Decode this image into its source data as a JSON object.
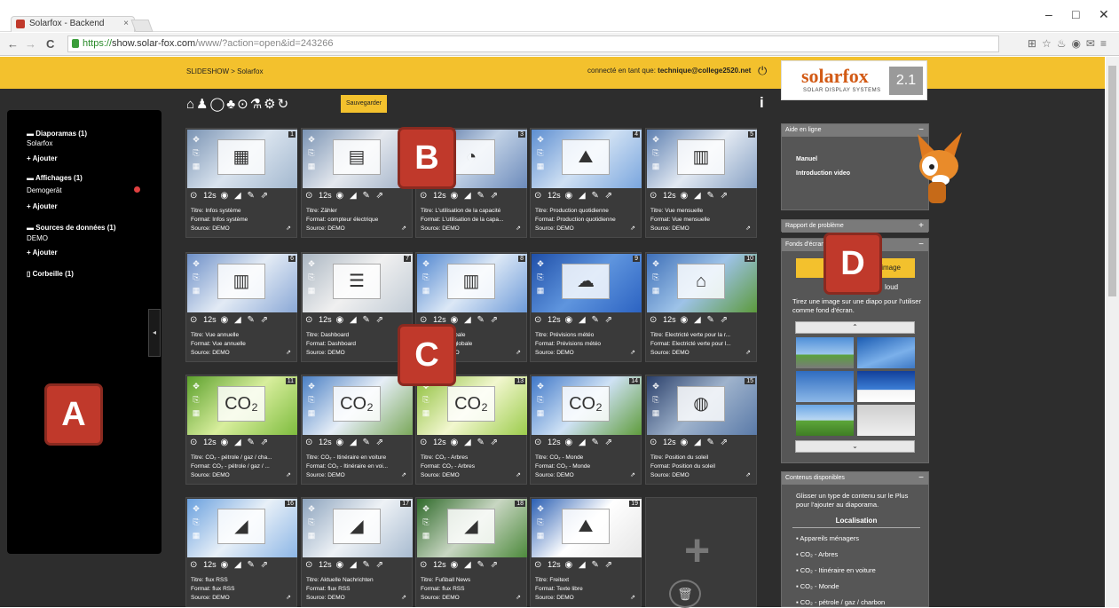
{
  "browser": {
    "tab_title": "Solarfox - Backend",
    "tab_close": "×",
    "url_secure": "https://",
    "url_host": "show.solar-fox.com",
    "url_path": "/www/?action=open&id=243266",
    "nav_back": "←",
    "nav_forward": "→",
    "nav_reload": "C",
    "win_minimize": "–",
    "win_maximize": "□",
    "win_close": "✕",
    "ext_icons": "⊞☆♨◉✉≡"
  },
  "header": {
    "breadcrumb": "SLIDESHOW > Solarfox",
    "connected_prefix": "connecté en tant que: ",
    "connected_user": "technique@college2520.net",
    "power_icon": "⏻"
  },
  "logo": {
    "brand": "solarfox",
    "tagline": "SOLAR DISPLAY SYSTEMS",
    "version": "2.1"
  },
  "sidebar": {
    "diaporamas": "Diaporamas (1)",
    "diaporama_item": "Solarfox",
    "add1": "+ Ajouter",
    "affichages": "Affichages (1)",
    "affichage_item": "Demogerät",
    "add2": "+ Ajouter",
    "sources": "Sources de données (1)",
    "source_item": "DEMO",
    "add3": "+ Ajouter",
    "corbeille": "Corbeille (1)",
    "collapse": "◂"
  },
  "toolbar": {
    "icons": "⌂♟◯♣⊙⚗⚙↻",
    "save": "Sauvegarder",
    "info": "i"
  },
  "cards": [
    {
      "num": "1",
      "icon": "▦",
      "title": "Titre: Infos système",
      "format": "Format: Infos système",
      "source": "Source: DEMO"
    },
    {
      "num": "2",
      "icon": "▤",
      "title": "Titre: Zähler",
      "format": "Format: compteur électrique",
      "source": "Source: DEMO"
    },
    {
      "num": "3",
      "icon": "◔",
      "title": "Titre: L'utilisation de la capacité",
      "format": "Format: L'utilisation de la capa...",
      "source": "Source: DEMO"
    },
    {
      "num": "4",
      "icon": "⛰",
      "title": "Titre: Production quotidienne",
      "format": "Format: Production quotidienne",
      "source": "Source: DEMO"
    },
    {
      "num": "5",
      "icon": "▥",
      "title": "Titre: Vue mensuelle",
      "format": "Format: Vue mensuelle",
      "source": "Source: DEMO"
    },
    {
      "num": "6",
      "icon": "▥",
      "title": "Titre: Vue annuelle",
      "format": "Format: Vue annuelle",
      "source": "Source: DEMO"
    },
    {
      "num": "7",
      "icon": "☰",
      "title": "Titre: Dashboard",
      "format": "Format: Dashboard",
      "source": "Source: DEMO"
    },
    {
      "num": "8",
      "icon": "▥",
      "title": "Titre: Vue globale",
      "format": "Format: Vue globale",
      "source": "Source: DEMO"
    },
    {
      "num": "9",
      "icon": "☁",
      "title": "Titre: Prévisions météo",
      "format": "Format: Prévisions météo",
      "source": "Source: DEMO"
    },
    {
      "num": "10",
      "icon": "⌂",
      "title": "Titre: Electricté verte pour la r...",
      "format": "Format: Electricté verte pour l...",
      "source": "Source: DEMO"
    },
    {
      "num": "11",
      "icon": "CO₂",
      "title": "Titre: CO₂ - pétrole / gaz / cha...",
      "format": "Format: CO₂ - pétrole / gaz / ...",
      "source": "Source: DEMO"
    },
    {
      "num": "12",
      "icon": "CO₂",
      "title": "Titre: CO₂ - Itinéraire en voiture",
      "format": "Format: CO₂ - Itinéraire en voi...",
      "source": "Source: DEMO"
    },
    {
      "num": "13",
      "icon": "CO₂",
      "title": "Titre: CO₂ - Arbres",
      "format": "Format: CO₂ - Arbres",
      "source": "Source: DEMO"
    },
    {
      "num": "14",
      "icon": "CO₂",
      "title": "Titre: CO₂ - Monde",
      "format": "Format: CO₂ - Monde",
      "source": "Source: DEMO"
    },
    {
      "num": "15",
      "icon": "◍",
      "title": "Titre: Position du soleil",
      "format": "Format: Position du soleil",
      "source": "Source: DEMO"
    },
    {
      "num": "16",
      "icon": "◢",
      "title": "Titre: flux RSS",
      "format": "Format: flux RSS",
      "source": "Source: DEMO"
    },
    {
      "num": "17",
      "icon": "◢",
      "title": "Titre: Aktuelle Nachrichten",
      "format": "Format: flux RSS",
      "source": "Source: DEMO"
    },
    {
      "num": "18",
      "icon": "◢",
      "title": "Titre: Fußball News",
      "format": "Format: flux RSS",
      "source": "Source: DEMO"
    },
    {
      "num": "19",
      "icon": "⛰",
      "title": "Titre: Freitext",
      "format": "Format: Texte libre",
      "source": "Source: DEMO"
    }
  ],
  "card_controls": {
    "clock": "⊙",
    "duration": "12s",
    "icons": "◉ ◢ ✎ ⇗",
    "side": "✥ ⎘ ▦",
    "ext": "⇗"
  },
  "add_slide": {
    "plus": "+",
    "trash": "🗑"
  },
  "help_panel": {
    "title": "Aide en ligne",
    "toggle": "−",
    "manual": "Manuel",
    "video": "Introduction video"
  },
  "problem_panel": {
    "title": "Rapport de problème",
    "toggle": "+"
  },
  "wallpaper_panel": {
    "title": "Fonds d'écran",
    "toggle": "−",
    "button_text": "image",
    "cloud_text": "loud",
    "hint": "Tirez une image sur une diapo pour l'utiliser comme fond d'écran.",
    "up": "⌃",
    "down": "⌄"
  },
  "content_panel": {
    "title": "Contenus disponibles",
    "toggle": "−",
    "hint": "Glisser un type de contenu sur le Plus pour l'ajouter au diaporama.",
    "section": "Localisation",
    "items": [
      "Appareils ménagers",
      "CO₂ - Arbres",
      "CO₂ - Itinéraire en voiture",
      "CO₂ - Monde",
      "CO₂ - pétrole / gaz / charbon"
    ]
  },
  "markers": [
    "A",
    "B",
    "C",
    "D"
  ]
}
